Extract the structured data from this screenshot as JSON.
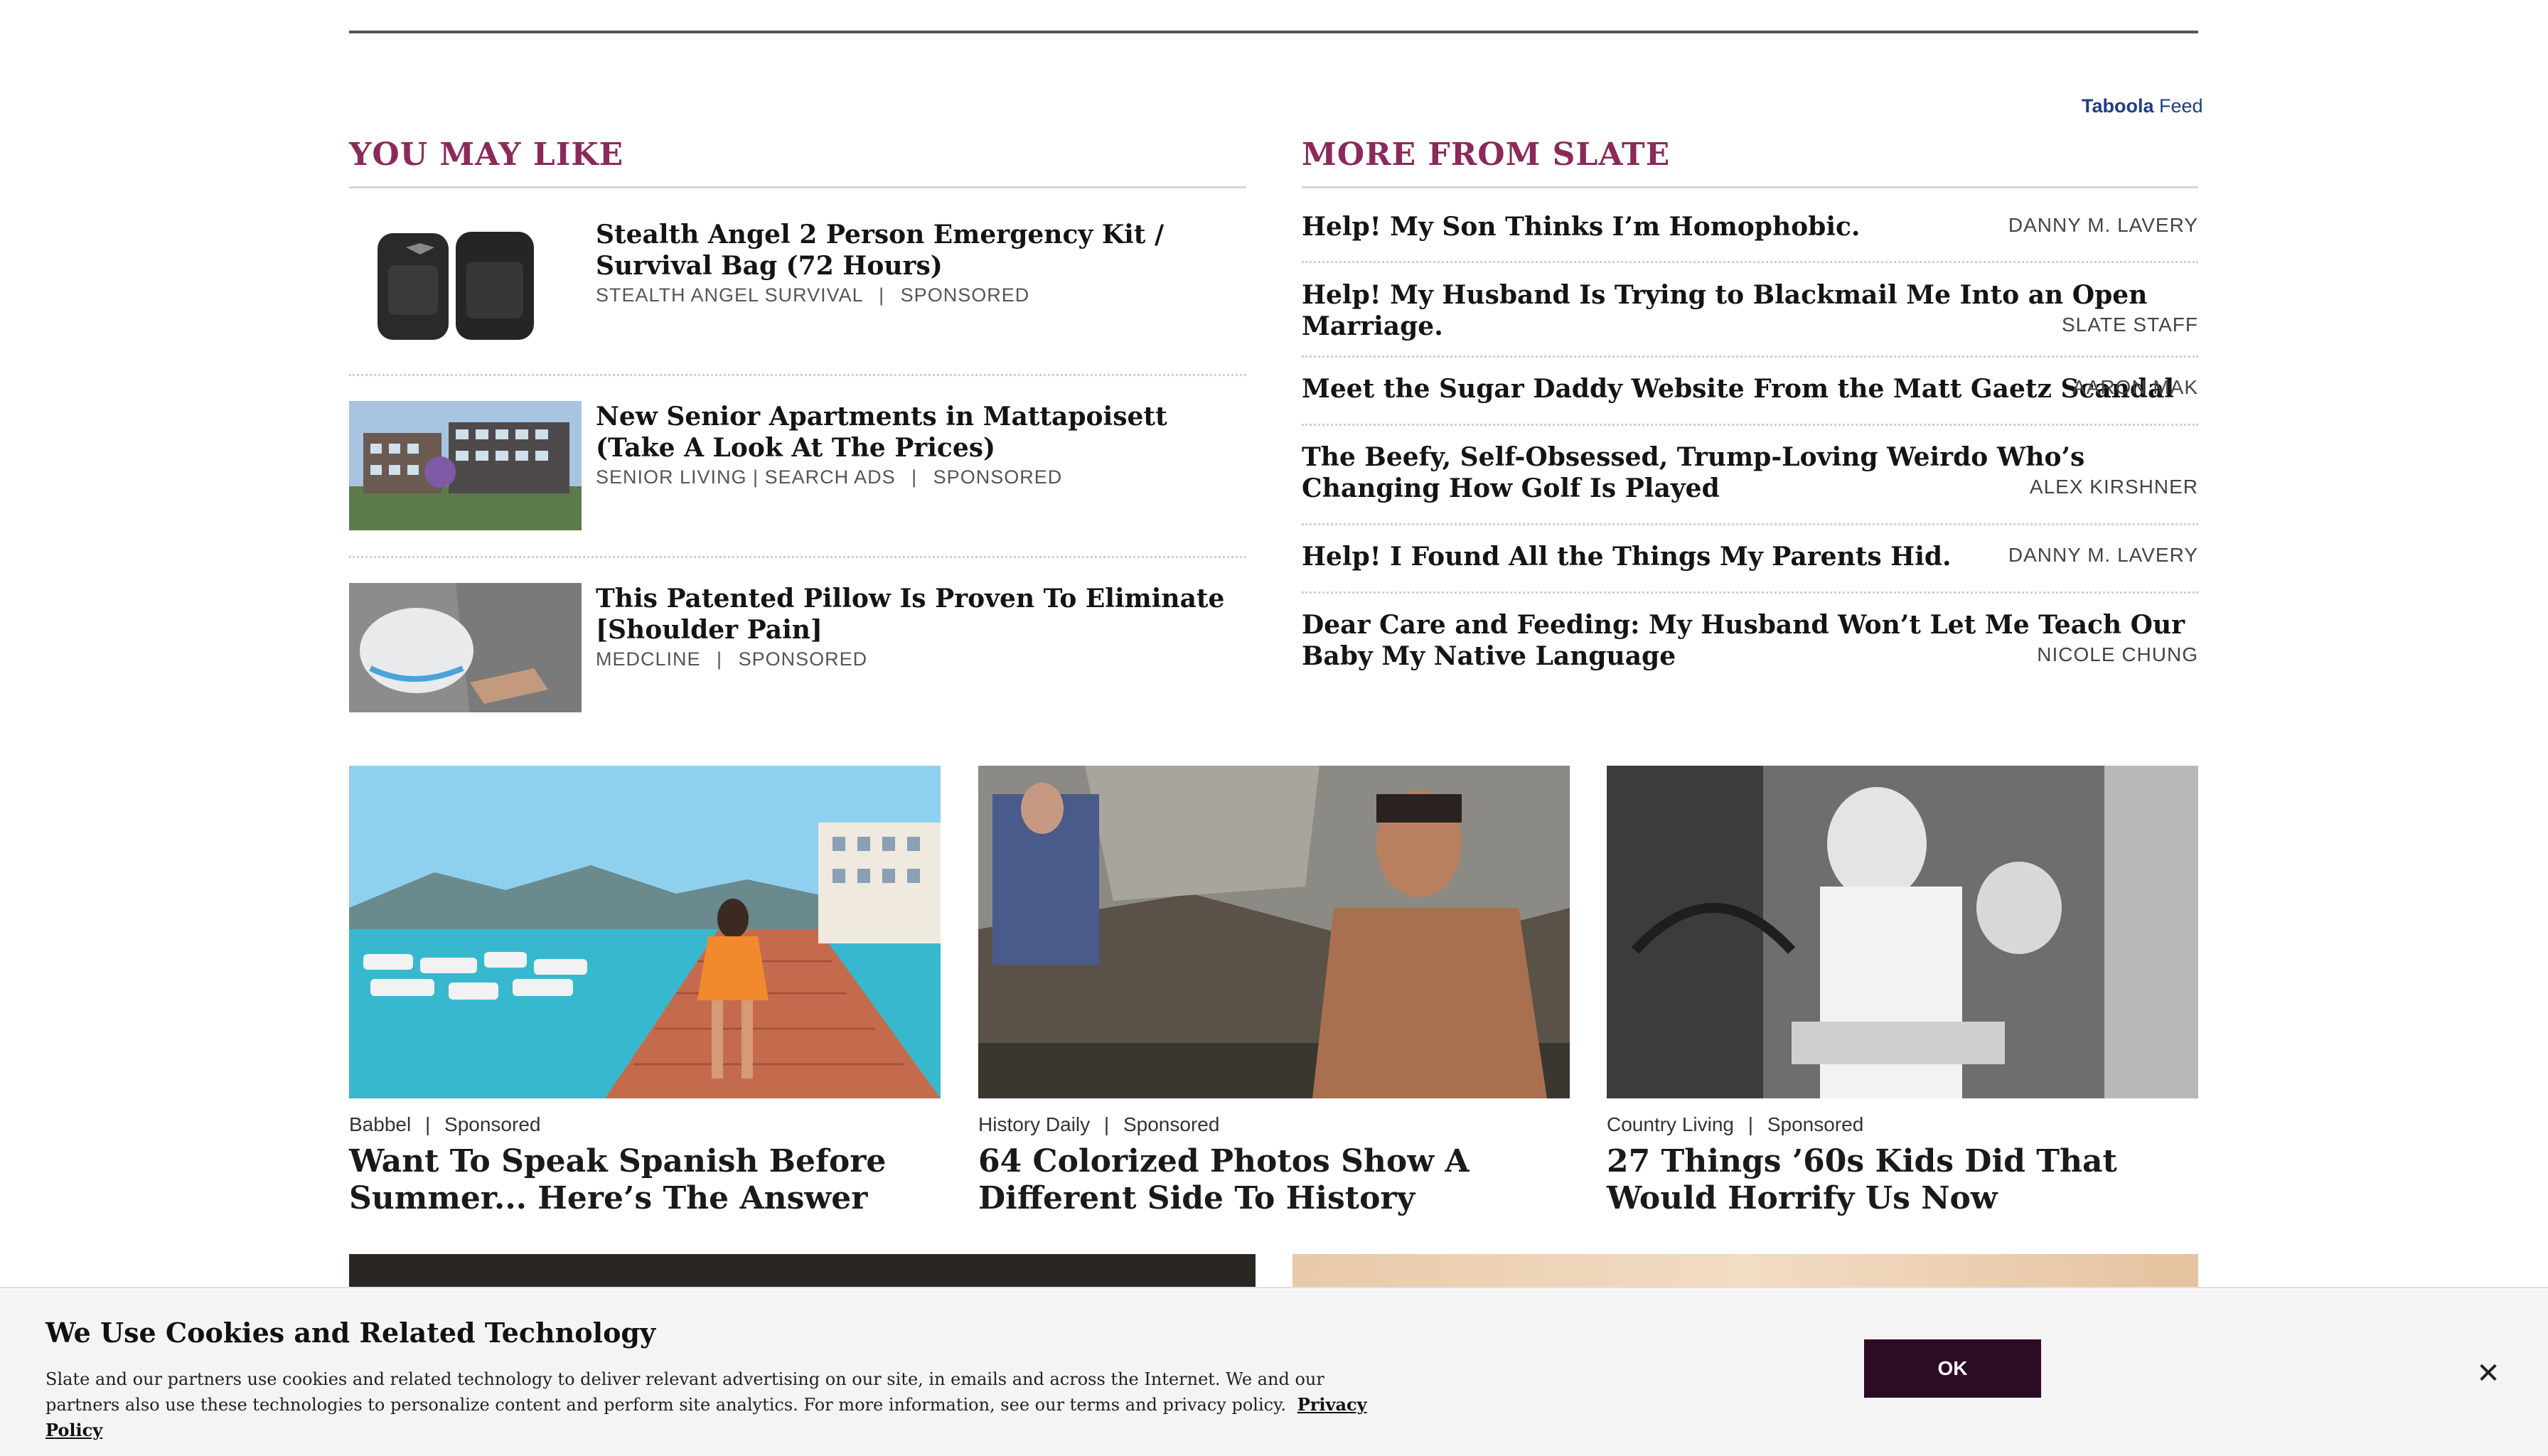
{
  "taboola": {
    "brand": "Taboola",
    "suffix": " Feed"
  },
  "you_may_like": {
    "heading": "YOU MAY LIKE",
    "items": [
      {
        "title": "Stealth Angel 2 Person Emergency Kit / Survival Bag (72 Hours)",
        "source": "STEALTH ANGEL SURVIVAL",
        "sep": "|",
        "tag": "SPONSORED"
      },
      {
        "title": "New Senior Apartments in Mattapoisett (Take A Look At The Prices)",
        "source": "SENIOR LIVING | SEARCH ADS",
        "sep": "|",
        "tag": "SPONSORED"
      },
      {
        "title": "This Patented Pillow Is Proven To Eliminate [Shoulder Pain]",
        "source": "MEDCLINE",
        "sep": "|",
        "tag": "SPONSORED"
      }
    ]
  },
  "more_from_slate": {
    "heading": "MORE FROM SLATE",
    "items": [
      {
        "title": "Help! My Son Thinks I’m Homophobic.",
        "author": "DANNY M. LAVERY"
      },
      {
        "title": "Help! My Husband Is Trying to Blackmail Me Into an Open Marriage.",
        "author": "SLATE STAFF"
      },
      {
        "title": "Meet the Sugar Daddy Website From the Matt Gaetz Scandal",
        "author": "AARON MAK"
      },
      {
        "title": "The Beefy, Self-Obsessed, Trump-Loving Weirdo Who’s Changing How Golf Is Played",
        "author": "ALEX KIRSHNER"
      },
      {
        "title": "Help! I Found All the Things My Parents Hid.",
        "author": "DANNY M. LAVERY"
      },
      {
        "title": "Dear Care and Feeding: My Husband Won’t Let Me Teach Our Baby My Native Language",
        "author": "NICOLE CHUNG"
      }
    ]
  },
  "cards": [
    {
      "source": "Babbel",
      "sep": "|",
      "tag": "Sponsored",
      "title": "Want To Speak Spanish Before Summer... Here’s The Answer"
    },
    {
      "source": "History Daily",
      "sep": "|",
      "tag": "Sponsored",
      "title": "64 Colorized Photos Show A Different Side To History"
    },
    {
      "source": "Country Living",
      "sep": "|",
      "tag": "Sponsored",
      "title": "27 Things ’60s Kids Did That Would Horrify Us Now"
    }
  ],
  "cookie": {
    "title": "We Use Cookies and Related Technology",
    "text": "Slate and our partners use cookies and related technology to deliver relevant advertising on our site, in emails and across the Internet. We and our partners also use these technologies to personalize content and perform site analytics. For more information, see our terms and privacy policy.",
    "link": "Privacy Policy",
    "ok": "OK",
    "close_glyph": "✕"
  },
  "colors": {
    "accent": "#8b2a5a",
    "ok_button": "#2c0b26",
    "taboola": "#1f3c88"
  }
}
